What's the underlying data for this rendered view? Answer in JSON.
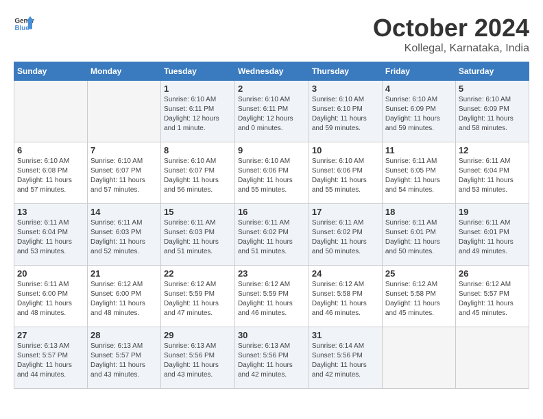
{
  "header": {
    "logo_general": "General",
    "logo_blue": "Blue",
    "title": "October 2024",
    "subtitle": "Kollegal, Karnataka, India"
  },
  "days_of_week": [
    "Sunday",
    "Monday",
    "Tuesday",
    "Wednesday",
    "Thursday",
    "Friday",
    "Saturday"
  ],
  "weeks": [
    [
      {
        "day": "",
        "detail": ""
      },
      {
        "day": "",
        "detail": ""
      },
      {
        "day": "1",
        "detail": "Sunrise: 6:10 AM\nSunset: 6:11 PM\nDaylight: 12 hours\nand 1 minute."
      },
      {
        "day": "2",
        "detail": "Sunrise: 6:10 AM\nSunset: 6:11 PM\nDaylight: 12 hours\nand 0 minutes."
      },
      {
        "day": "3",
        "detail": "Sunrise: 6:10 AM\nSunset: 6:10 PM\nDaylight: 11 hours\nand 59 minutes."
      },
      {
        "day": "4",
        "detail": "Sunrise: 6:10 AM\nSunset: 6:09 PM\nDaylight: 11 hours\nand 59 minutes."
      },
      {
        "day": "5",
        "detail": "Sunrise: 6:10 AM\nSunset: 6:09 PM\nDaylight: 11 hours\nand 58 minutes."
      }
    ],
    [
      {
        "day": "6",
        "detail": "Sunrise: 6:10 AM\nSunset: 6:08 PM\nDaylight: 11 hours\nand 57 minutes."
      },
      {
        "day": "7",
        "detail": "Sunrise: 6:10 AM\nSunset: 6:07 PM\nDaylight: 11 hours\nand 57 minutes."
      },
      {
        "day": "8",
        "detail": "Sunrise: 6:10 AM\nSunset: 6:07 PM\nDaylight: 11 hours\nand 56 minutes."
      },
      {
        "day": "9",
        "detail": "Sunrise: 6:10 AM\nSunset: 6:06 PM\nDaylight: 11 hours\nand 55 minutes."
      },
      {
        "day": "10",
        "detail": "Sunrise: 6:10 AM\nSunset: 6:06 PM\nDaylight: 11 hours\nand 55 minutes."
      },
      {
        "day": "11",
        "detail": "Sunrise: 6:11 AM\nSunset: 6:05 PM\nDaylight: 11 hours\nand 54 minutes."
      },
      {
        "day": "12",
        "detail": "Sunrise: 6:11 AM\nSunset: 6:04 PM\nDaylight: 11 hours\nand 53 minutes."
      }
    ],
    [
      {
        "day": "13",
        "detail": "Sunrise: 6:11 AM\nSunset: 6:04 PM\nDaylight: 11 hours\nand 53 minutes."
      },
      {
        "day": "14",
        "detail": "Sunrise: 6:11 AM\nSunset: 6:03 PM\nDaylight: 11 hours\nand 52 minutes."
      },
      {
        "day": "15",
        "detail": "Sunrise: 6:11 AM\nSunset: 6:03 PM\nDaylight: 11 hours\nand 51 minutes."
      },
      {
        "day": "16",
        "detail": "Sunrise: 6:11 AM\nSunset: 6:02 PM\nDaylight: 11 hours\nand 51 minutes."
      },
      {
        "day": "17",
        "detail": "Sunrise: 6:11 AM\nSunset: 6:02 PM\nDaylight: 11 hours\nand 50 minutes."
      },
      {
        "day": "18",
        "detail": "Sunrise: 6:11 AM\nSunset: 6:01 PM\nDaylight: 11 hours\nand 50 minutes."
      },
      {
        "day": "19",
        "detail": "Sunrise: 6:11 AM\nSunset: 6:01 PM\nDaylight: 11 hours\nand 49 minutes."
      }
    ],
    [
      {
        "day": "20",
        "detail": "Sunrise: 6:11 AM\nSunset: 6:00 PM\nDaylight: 11 hours\nand 48 minutes."
      },
      {
        "day": "21",
        "detail": "Sunrise: 6:12 AM\nSunset: 6:00 PM\nDaylight: 11 hours\nand 48 minutes."
      },
      {
        "day": "22",
        "detail": "Sunrise: 6:12 AM\nSunset: 5:59 PM\nDaylight: 11 hours\nand 47 minutes."
      },
      {
        "day": "23",
        "detail": "Sunrise: 6:12 AM\nSunset: 5:59 PM\nDaylight: 11 hours\nand 46 minutes."
      },
      {
        "day": "24",
        "detail": "Sunrise: 6:12 AM\nSunset: 5:58 PM\nDaylight: 11 hours\nand 46 minutes."
      },
      {
        "day": "25",
        "detail": "Sunrise: 6:12 AM\nSunset: 5:58 PM\nDaylight: 11 hours\nand 45 minutes."
      },
      {
        "day": "26",
        "detail": "Sunrise: 6:12 AM\nSunset: 5:57 PM\nDaylight: 11 hours\nand 45 minutes."
      }
    ],
    [
      {
        "day": "27",
        "detail": "Sunrise: 6:13 AM\nSunset: 5:57 PM\nDaylight: 11 hours\nand 44 minutes."
      },
      {
        "day": "28",
        "detail": "Sunrise: 6:13 AM\nSunset: 5:57 PM\nDaylight: 11 hours\nand 43 minutes."
      },
      {
        "day": "29",
        "detail": "Sunrise: 6:13 AM\nSunset: 5:56 PM\nDaylight: 11 hours\nand 43 minutes."
      },
      {
        "day": "30",
        "detail": "Sunrise: 6:13 AM\nSunset: 5:56 PM\nDaylight: 11 hours\nand 42 minutes."
      },
      {
        "day": "31",
        "detail": "Sunrise: 6:14 AM\nSunset: 5:56 PM\nDaylight: 11 hours\nand 42 minutes."
      },
      {
        "day": "",
        "detail": ""
      },
      {
        "day": "",
        "detail": ""
      }
    ]
  ]
}
